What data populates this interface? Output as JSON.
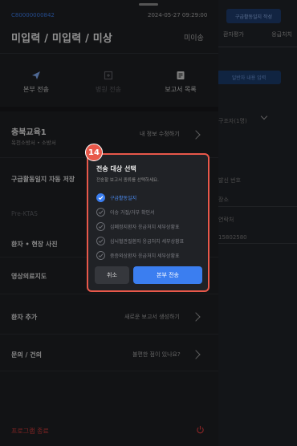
{
  "background": {
    "top_button": "구급활동일지 작성",
    "tabs": [
      "환자평가",
      "응급처치"
    ],
    "input_button": "일반자 내용 입력",
    "fields": [
      "구조자(1명)",
      "발신 번호",
      "장소",
      "연락처",
      "15802580"
    ]
  },
  "header": {
    "case_id": "C80000000842",
    "datetime": "2024-05-27 09:29:00",
    "title": "미입력 / 미입력 / 미상",
    "status": "미이송"
  },
  "actions": [
    {
      "label": "본부 전송",
      "icon": "send-icon"
    },
    {
      "label": "병원 전송",
      "icon": "hospital-icon"
    },
    {
      "label": "보고서 목록",
      "icon": "document-icon"
    }
  ],
  "org": {
    "name": "충북교육1",
    "sub": "옥천소방서 • 소방서",
    "edit_label": "내 정보 수정하기"
  },
  "rows": {
    "autosave": "구급활동일지 자동 저장",
    "prektas": "Pre-KTAS",
    "photo": "환자 • 현장 사진",
    "video": "영상의료지도",
    "add_patient": "환자 추가",
    "add_patient_hint": "새로운 보고서 생성하기",
    "inquiry": "문의 / 건의",
    "inquiry_hint": "불편한 점이 있나요?",
    "exit": "프로그램 종료"
  },
  "modal": {
    "step": "14",
    "title": "전송 대상 선택",
    "subtitle": "전송할 보고서 종류를 선택하세요.",
    "options": [
      {
        "label": "구급활동일지",
        "checked": true
      },
      {
        "label": "이송 거절/거부 확인서",
        "checked": false
      },
      {
        "label": "심폐정지환자 응급처치 세부상황표",
        "checked": false
      },
      {
        "label": "심뇌혈관질환자 응급처치 세부상황표",
        "checked": false
      },
      {
        "label": "중증외상환자 응급처치 세부상황표",
        "checked": false
      }
    ],
    "cancel_label": "취소",
    "confirm_label": "본부 전송"
  },
  "colors": {
    "accent": "#3b7ef0",
    "highlight": "#e8584a",
    "danger": "#d23a3a"
  }
}
